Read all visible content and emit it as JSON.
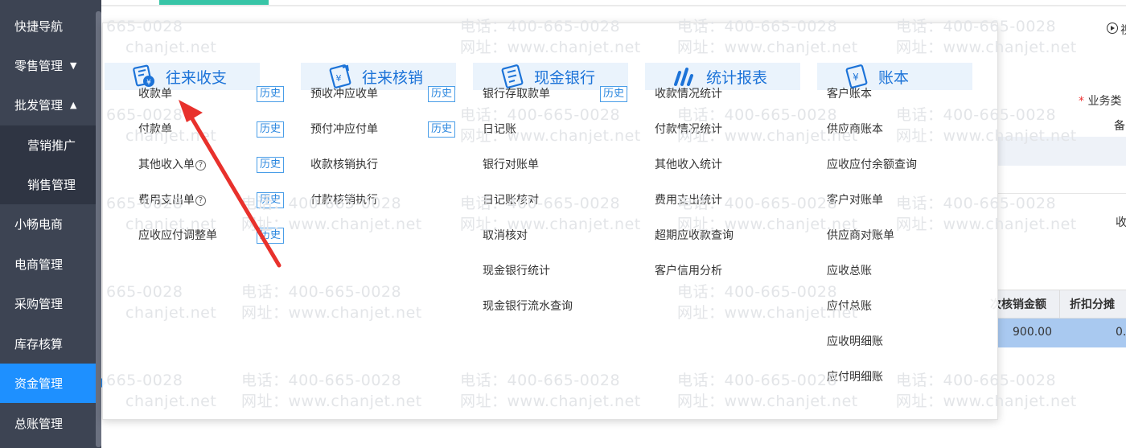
{
  "sidebar": {
    "items": [
      {
        "label": "快捷导航"
      },
      {
        "label": "零售管理",
        "caret": "▼"
      },
      {
        "label": "批发管理",
        "caret": "▲"
      },
      {
        "label": "营销推广"
      },
      {
        "label": "销售管理"
      },
      {
        "label": "小畅电商"
      },
      {
        "label": "电商管理"
      },
      {
        "label": "采购管理"
      },
      {
        "label": "库存核算"
      },
      {
        "label": "资金管理",
        "active": true
      },
      {
        "label": "总账管理"
      }
    ]
  },
  "background": {
    "top_right_text": "视",
    "business_type_label": "业务类",
    "required_mark": "*",
    "remark_label": "备",
    "receipt_label": "收",
    "col_verified_amount": "次核销金额",
    "col_discount": "折扣分摊",
    "row_amount": "900.00",
    "row_discount": "0."
  },
  "watermark": {
    "phone": "电话：400-665-0028",
    "phone_short": "665-0028",
    "site": "网址：www.chanjet.net",
    "site_short": "chanjet.net"
  },
  "menu": {
    "history_label": "历史",
    "help_mark": "?",
    "categories": [
      {
        "title": "往来收支",
        "icon": "receipt-payment-icon",
        "items": [
          {
            "label": "收款单",
            "history": true
          },
          {
            "label": "付款单",
            "history": true
          },
          {
            "label": "其他收入单",
            "help": true,
            "history": true
          },
          {
            "label": "费用支出单",
            "help": true,
            "history": true
          },
          {
            "label": "应收应付调整单",
            "history": true
          }
        ]
      },
      {
        "title": "往来核销",
        "icon": "write-off-icon",
        "items": [
          {
            "label": "预收冲应收单",
            "history": true
          },
          {
            "label": "预付冲应付单",
            "history": true
          },
          {
            "label": "收款核销执行"
          },
          {
            "label": "付款核销执行"
          }
        ]
      },
      {
        "title": "现金银行",
        "icon": "cash-bank-icon",
        "items": [
          {
            "label": "银行存取款单",
            "history": true
          },
          {
            "label": "日记账"
          },
          {
            "label": "银行对账单"
          },
          {
            "label": "日记账核对"
          },
          {
            "label": "取消核对"
          },
          {
            "label": "现金银行统计"
          },
          {
            "label": "现金银行流水查询"
          }
        ]
      },
      {
        "title": "统计报表",
        "icon": "statistics-icon",
        "items": [
          {
            "label": "收款情况统计"
          },
          {
            "label": "付款情况统计"
          },
          {
            "label": "其他收入统计"
          },
          {
            "label": "费用支出统计"
          },
          {
            "label": "超期应收款查询"
          },
          {
            "label": "客户信用分析"
          }
        ]
      },
      {
        "title": "账本",
        "icon": "ledger-icon",
        "items": [
          {
            "label": "客户账本"
          },
          {
            "label": "供应商账本"
          },
          {
            "label": "应收应付余额查询"
          },
          {
            "label": "客户对账单"
          },
          {
            "label": "供应商对账单"
          },
          {
            "label": "应收总账"
          },
          {
            "label": "应付总账"
          },
          {
            "label": "应收明细账"
          },
          {
            "label": "应付明细账"
          }
        ]
      }
    ]
  },
  "colors": {
    "sidebar_bg": "#3d4453",
    "sidebar_active": "#1e90ff",
    "accent_blue": "#1c73d8",
    "arrow_red": "#e8312c",
    "tab_green": "#38c5a7"
  }
}
